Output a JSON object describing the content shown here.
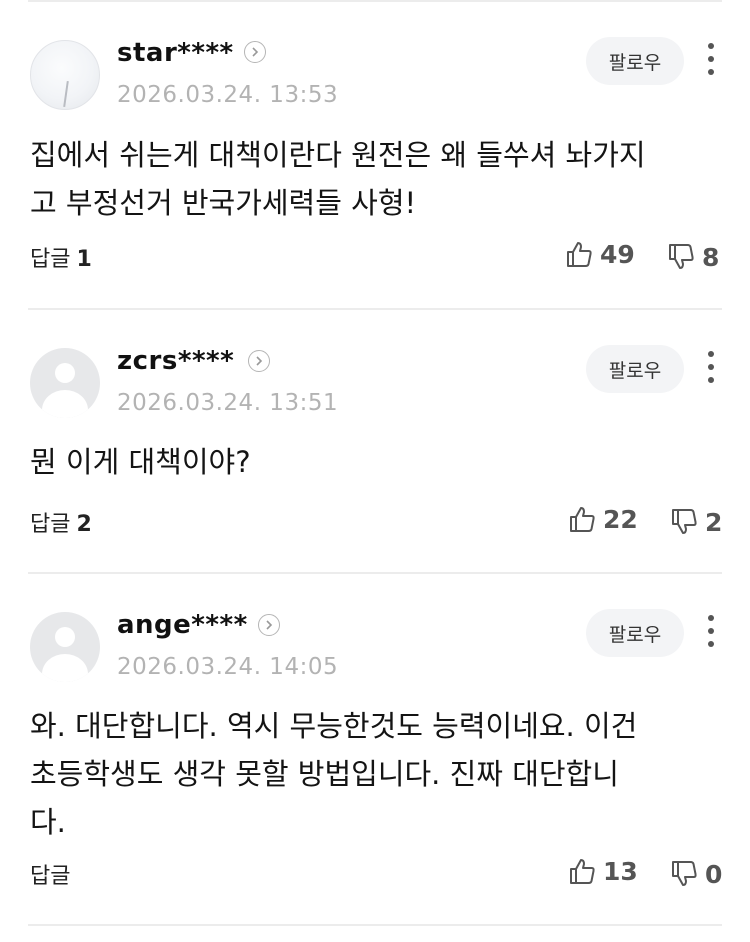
{
  "comments": [
    {
      "nickname": "star****",
      "timestamp": "2026.03.24. 13:53",
      "follow_label": "팔로우",
      "text": "집에서 쉬는게 대책이란다 원전은 왜 들쑤셔 놔가지\n고 부정선거 반국가세력들 사형!",
      "reply_label": "답글",
      "reply_count": "1",
      "likes": "49",
      "dislikes": "8",
      "avatar": "photo"
    },
    {
      "nickname": "zcrs****",
      "timestamp": "2026.03.24. 13:51",
      "follow_label": "팔로우",
      "text": "뭔 이게 대책이야?",
      "reply_label": "답글",
      "reply_count": "2",
      "likes": "22",
      "dislikes": "2",
      "avatar": "default"
    },
    {
      "nickname": "ange****",
      "timestamp": "2026.03.24. 14:05",
      "follow_label": "팔로우",
      "text": "와. 대단합니다. 역시 무능한것도 능력이네요. 이건\n초등학생도 생각 못할 방법입니다. 진짜 대단합니\n다.",
      "reply_label": "답글",
      "reply_count": "",
      "likes": "13",
      "dislikes": "0",
      "avatar": "default"
    }
  ],
  "icons": {
    "profile_chevron": "chevron-right-icon",
    "more": "more-vertical-icon",
    "like": "thumbs-up-icon",
    "dislike": "thumbs-down-icon"
  },
  "colors": {
    "divider": "#ececec",
    "timestamp": "#b3b3b3",
    "follow_bg": "#f3f4f6",
    "vote_icon": "#555555"
  }
}
